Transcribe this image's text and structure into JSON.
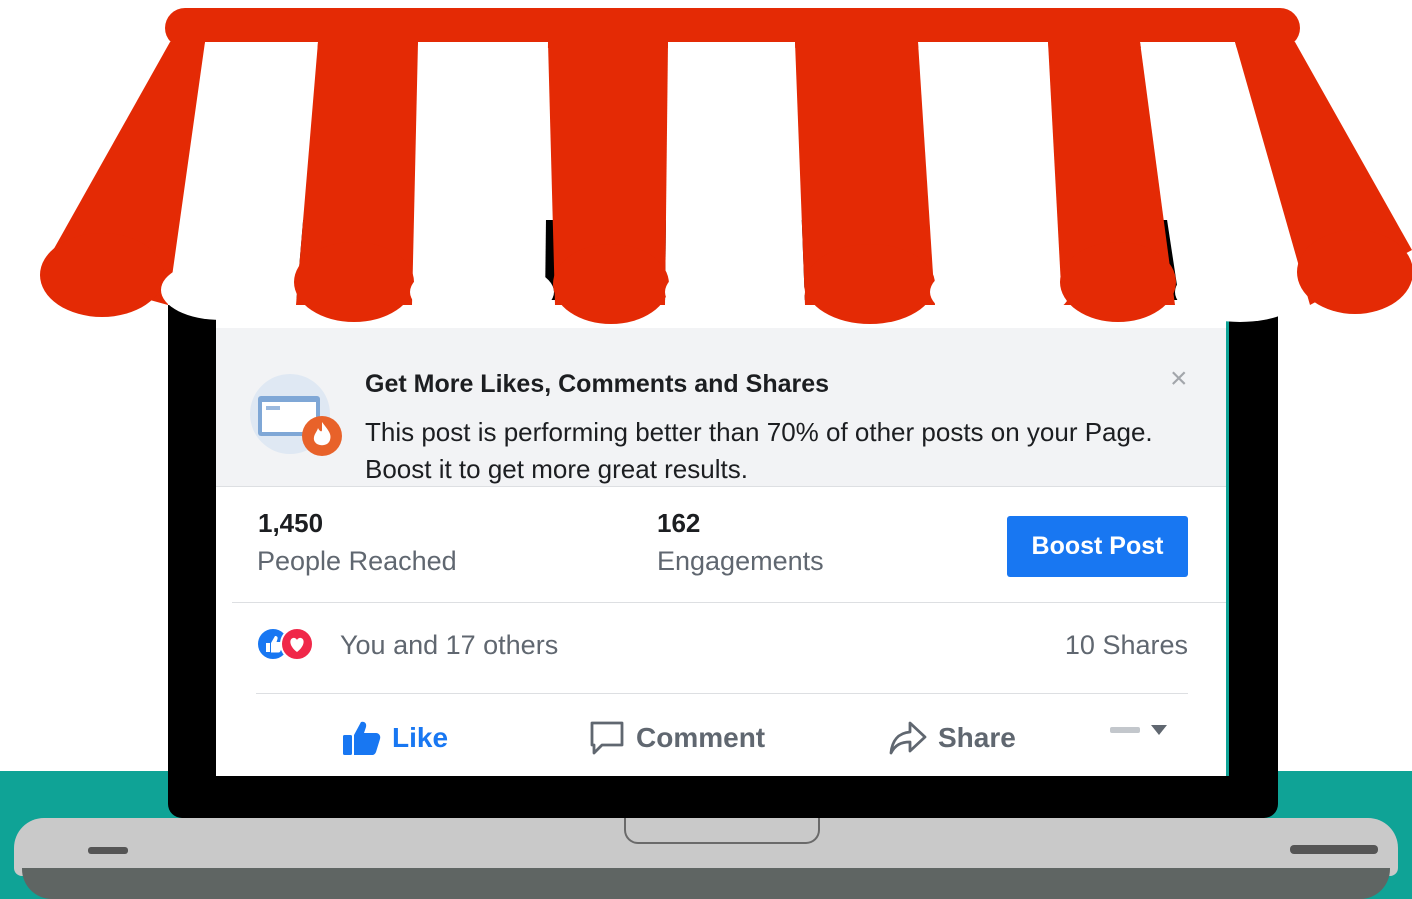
{
  "notice": {
    "title": "Get More Likes, Comments and Shares",
    "body": "This post is performing better than 70% of other posts on your Page. Boost it to get more great results.",
    "close": "×"
  },
  "metrics": {
    "reach_value": "1,450",
    "reach_label": "People Reached",
    "engagement_value": "162",
    "engagement_label": "Engagements"
  },
  "boost_button": "Boost Post",
  "reactions": {
    "icons": [
      "like-icon",
      "love-icon"
    ],
    "summary": "You and 17 others",
    "shares": "10 Shares"
  },
  "actions": {
    "like": "Like",
    "comment": "Comment",
    "share": "Share"
  },
  "colors": {
    "awning_red": "#e42a05",
    "facebook_blue": "#1877f2",
    "teal": "#0fa396",
    "love_red": "#f02849"
  }
}
